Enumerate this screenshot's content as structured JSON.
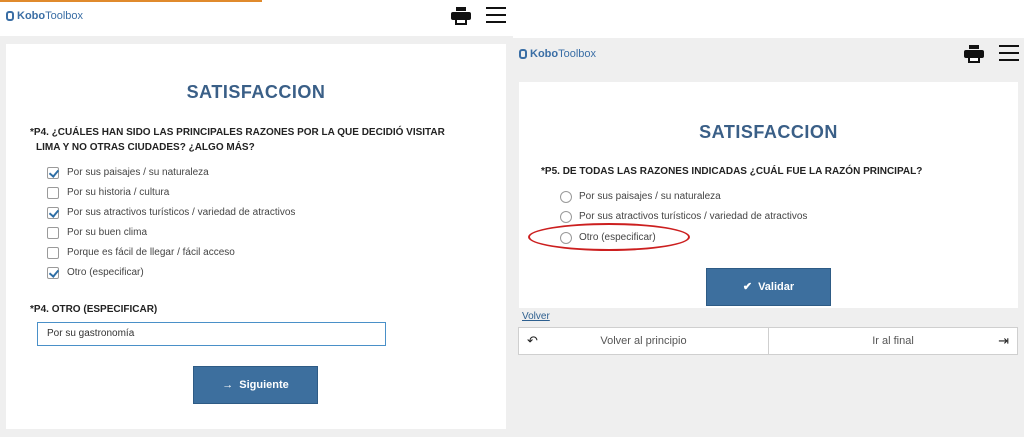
{
  "left": {
    "brand": {
      "prefix": "Kobo",
      "suffix": "Toolbox"
    },
    "icons": {
      "print": "printer-icon",
      "menu": "hamburger-menu-icon"
    },
    "title": "SATISFACCION",
    "q4": {
      "required_mark": "*",
      "text_line1": "P4. ¿CUÁLES HAN SIDO LAS PRINCIPALES RAZONES POR LA QUE DECIDIÓ VISITAR",
      "text_line2": "LIMA Y NO OTRAS CIUDADES? ¿ALGO MÁS?",
      "options": [
        {
          "label": "Por sus paisajes / su naturaleza",
          "checked": true
        },
        {
          "label": "Por su historia / cultura",
          "checked": false
        },
        {
          "label": "Por sus atractivos turísticos / variedad de atractivos",
          "checked": true
        },
        {
          "label": "Por su buen clima",
          "checked": false
        },
        {
          "label": "Porque es fácil de llegar / fácil acceso",
          "checked": false
        },
        {
          "label": "Otro (especificar)",
          "checked": true
        }
      ]
    },
    "q4_other": {
      "required_mark": "*",
      "label": "P4. OTRO (ESPECIFICAR)",
      "value": "Por su gastronomía"
    },
    "next_button": {
      "icon": "→",
      "label": "Siguiente"
    }
  },
  "right": {
    "brand": {
      "prefix": "Kobo",
      "suffix": "Toolbox"
    },
    "title": "SATISFACCION",
    "q5": {
      "required_mark": "*",
      "text": "P5. DE TODAS LAS RAZONES INDICADAS ¿CUÁL FUE LA RAZÓN PRINCIPAL?",
      "options": [
        {
          "label": "Por sus paisajes / su naturaleza"
        },
        {
          "label": "Por sus atractivos turísticos / variedad de atractivos"
        },
        {
          "label": "Otro (especificar)"
        }
      ]
    },
    "validate_button": {
      "icon": "✔",
      "label": "Validar"
    },
    "back_link": "Volver",
    "nav": {
      "back_to_start": "Volver al principio",
      "go_to_end": "Ir al final"
    },
    "highlight_color": "#cc1f1f"
  }
}
